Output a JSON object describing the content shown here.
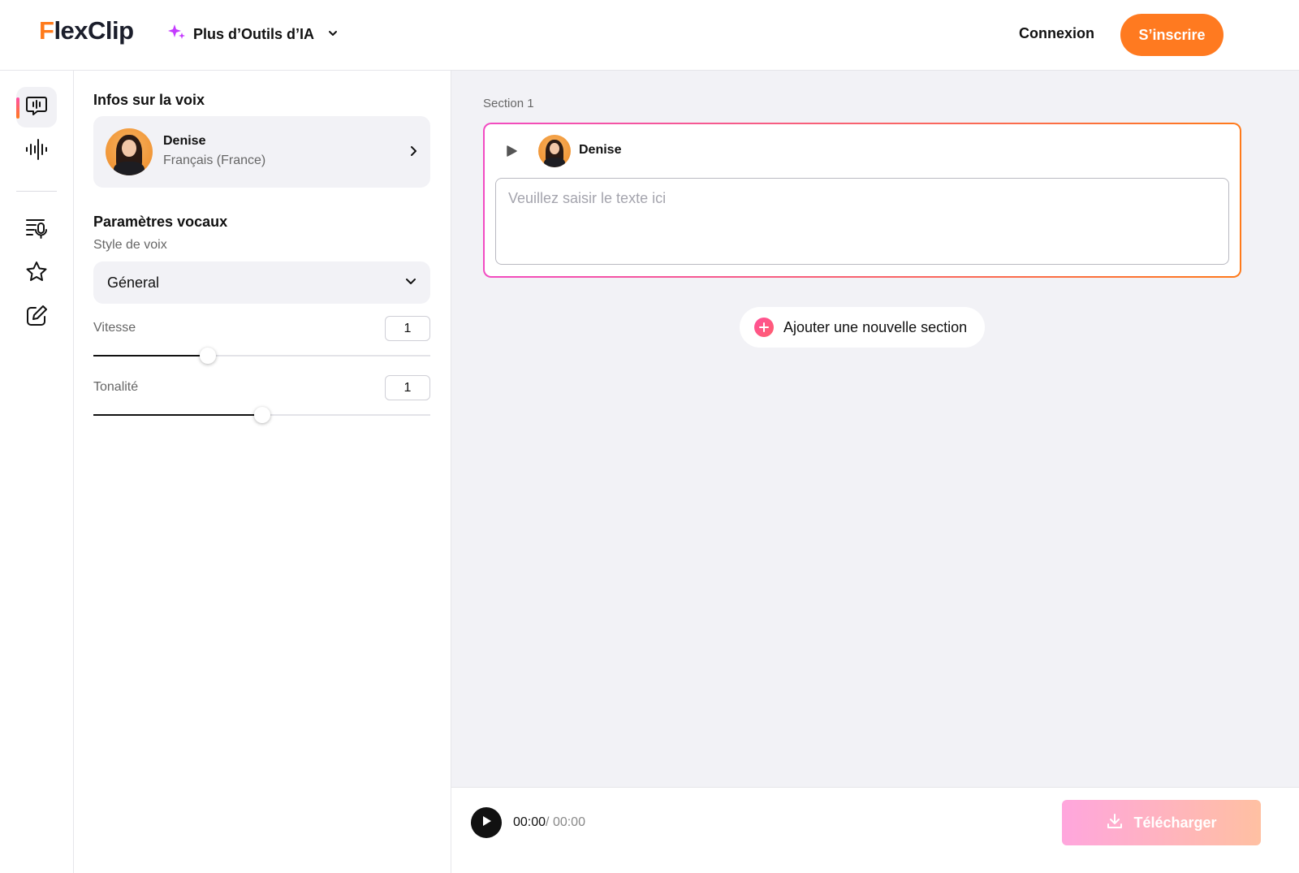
{
  "header": {
    "logo_first": "F",
    "logo_rest": "lexClip",
    "ai_tools_label": "Plus d’Outils d’IA",
    "login_label": "Connexion",
    "signup_label": "S’inscrire"
  },
  "colors": {
    "accent_orange": "#ff7a20",
    "accent_pink": "#f24bc2",
    "panel_bg": "#f2f2f6"
  },
  "rail": {
    "items": [
      {
        "icon": "chat-voice-icon",
        "active": true
      },
      {
        "icon": "soundwave-icon",
        "active": false
      },
      {
        "icon": "script-mic-icon",
        "active": false
      },
      {
        "icon": "star-icon",
        "active": false
      },
      {
        "icon": "edit-icon",
        "active": false
      }
    ]
  },
  "panel": {
    "voice_info_title": "Infos sur la voix",
    "voice": {
      "name": "Denise",
      "language": "Français (France)"
    },
    "vocal_params_title": "Paramètres vocaux",
    "style_label": "Style de voix",
    "style_value": "Géneral",
    "speed_label": "Vitesse",
    "speed_value": "1",
    "speed_fraction": 0.34,
    "pitch_label": "Tonalité",
    "pitch_value": "1",
    "pitch_fraction": 0.5
  },
  "editor": {
    "section_label": "Section 1",
    "voice_name": "Denise",
    "text_placeholder": "Veuillez saisir le texte ici",
    "add_section_label": "Ajouter une nouvelle section"
  },
  "player": {
    "current_time": "00:00",
    "total_time": "/ 00:00",
    "download_label": "Télécharger"
  }
}
